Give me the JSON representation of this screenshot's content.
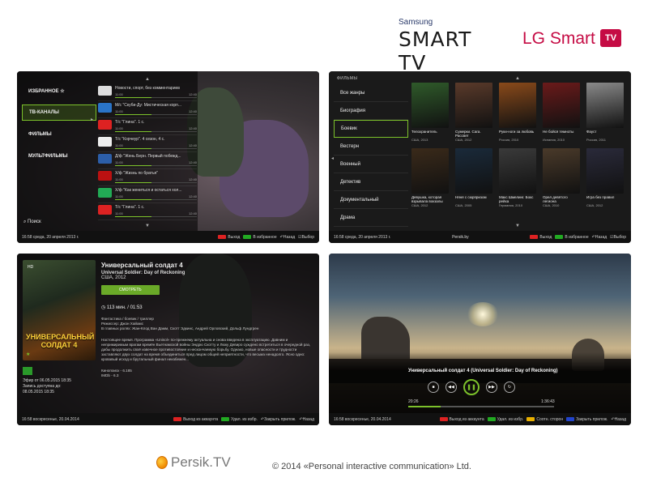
{
  "brands": {
    "samsung_top": "Samsung",
    "samsung_main": "SMART TV",
    "lg_text": "LG Smart",
    "lg_badge": "TV"
  },
  "panel1": {
    "menu": [
      "ИЗБРАННОЕ ☆",
      "ТВ-КАНАЛЫ",
      "ФИЛЬМЫ",
      "МУЛЬТФИЛЬМЫ"
    ],
    "active_menu": 1,
    "search_label": "Поиск",
    "channels": [
      {
        "num": "",
        "title": "Новости, спорт, без комментариев",
        "start": "11:00",
        "end": "12:40",
        "progress": 0.45,
        "logo": "#ddd"
      },
      {
        "num": "",
        "title": "М/с \"Скуби-Ду: Мистическая корп...",
        "start": "11:00",
        "end": "12:40",
        "progress": 0.45,
        "logo": "#2a74c8"
      },
      {
        "num": "",
        "title": "Т/с \"Глина\". 1 с.",
        "start": "11:00",
        "end": "12:40",
        "progress": 0.45,
        "logo": "#d22"
      },
      {
        "num": "",
        "title": "Т/с \"Корчеур\". 4 сезон, 4 с.",
        "start": "11:00",
        "end": "12:40",
        "progress": 0.45,
        "logo": "#eee"
      },
      {
        "num": "",
        "title": "Д/ф \"Жень Берн. Первый побежд...",
        "start": "11:00",
        "end": "12:40",
        "progress": 0.45,
        "logo": "#2c5ea8"
      },
      {
        "num": "",
        "title": "Х/ф \"Жизнь по братья\"",
        "start": "11:00",
        "end": "12:40",
        "progress": 0.45,
        "logo": "#b11"
      },
      {
        "num": "",
        "title": "Х/ф \"Как жениться и остаться хол...",
        "start": "11:00",
        "end": "12:40",
        "progress": 0.45,
        "logo": "#2a5"
      },
      {
        "num": "",
        "title": "Т/с \"Глина\". 1 с.",
        "start": "11:00",
        "end": "12:40",
        "progress": 0.45,
        "logo": "#d22"
      }
    ],
    "status_left": "16:58  среда, 20 апреля 2013 г.",
    "hints": [
      {
        "key": "red",
        "label": "Выход"
      },
      {
        "key": "green",
        "label": "В избранное"
      },
      {
        "key": "none",
        "label": "Назад"
      },
      {
        "key": "none",
        "label": "Выбор"
      }
    ]
  },
  "panel2": {
    "section": "ФИЛЬМЫ",
    "genres": [
      "Все жанры",
      "Биография",
      "Боевик",
      "Вестерн",
      "Военный",
      "Детектив",
      "Документальный",
      "Драма"
    ],
    "active_genre": 2,
    "posters": [
      {
        "title": "Телохранитель",
        "meta": "США, 2013",
        "color": "#2f5a2a"
      },
      {
        "title": "Сумерки. Сага. Рассвет",
        "meta": "США, 2012",
        "color": "#5a3a2a"
      },
      {
        "title": "Руки-ноги за любовь",
        "meta": "Россия, 2010",
        "color": "#8a4a1a"
      },
      {
        "title": "Не бойся темноты",
        "meta": "Испания, 2010",
        "color": "#6a1a1a"
      },
      {
        "title": "Фауст",
        "meta": "Россия, 2011",
        "color": "#8a8a8a"
      },
      {
        "title": "Девушка, которая взрывала вокзалы",
        "meta": "США, 2012",
        "color": "#3a2a1a"
      },
      {
        "title": "Няня с сюрпризом",
        "meta": "США, 2005",
        "color": "#1a2a3a"
      },
      {
        "title": "Макс Шмелинг. Бокс рейха",
        "meta": "Германия, 2010",
        "color": "#3a3a3a"
      },
      {
        "title": "Орел девятого легиона",
        "meta": "США, 2010",
        "color": "#4a3a2a"
      },
      {
        "title": "Игра без правил",
        "meta": "США, 2012",
        "color": "#2a2a3a"
      }
    ],
    "status_left": "16:58  среда, 20 апреля 2013 г.",
    "center_logo": "Persik.by",
    "hints": [
      {
        "key": "red",
        "label": "Выход"
      },
      {
        "key": "green",
        "label": "В избранное"
      },
      {
        "key": "none",
        "label": "Назад"
      },
      {
        "key": "none",
        "label": "Выбор"
      }
    ]
  },
  "panel3": {
    "poster_title": "УНИВЕРСАЛЬНЫЙ СОЛДАТ 4",
    "poster_badge": "HD",
    "title": "Универсальный солдат 4",
    "original_title": "Universal Soldier: Day of Reckoning",
    "country_year": "США, 2012",
    "watch_label": "СМОТРЕТЬ",
    "duration": "113 мин. / 01:53",
    "genre": "Фантастика / боевик / триллер",
    "director": "Режиссер: Джон Хайамс",
    "cast": "В главных ролях: Жан-Клод Ван Дамм, Скотт Эдкинс, Андрей Орловский, Дольф Лундгрен",
    "description": "Настоящее время. Программа «Unisol» по-прежнему актуальна и снова введена в эксплуатацию. Давним и непримиримым врагам времён Вьетнамской войны Эндрю Скотту и Люку Девиро суждено встретиться в очередной раз, дабы продолжить своё извечное противостояние и нескончаемую борьбу. Однако, новые опасности и трудности заставляют двух солдат на время объединиться пред лицом общей неприятности, что весьма ненадолго. Ясно одно: кровавый исход и брутальный финал неизбежен...",
    "kinopoisk": "Кинопоиск - 6.185",
    "imdb": "IMDb - 6.3",
    "air_line1": "Эфир от 06.05.2015   18:35",
    "air_line2": "Запись доступна до:",
    "air_line3": "08.05.2015   18:35",
    "status_left": "16:58   воскресенье, 20.04.2014",
    "hints": [
      {
        "key": "red",
        "label": "Выход из аккаунта"
      },
      {
        "key": "green",
        "label": "Удал. из избр."
      },
      {
        "key": "none",
        "label": "Закрыть прилож."
      },
      {
        "key": "none",
        "label": "Назад"
      }
    ]
  },
  "panel4": {
    "title": "Универсальный солдат 4 (Universal Soldier: Day of Reckoning)",
    "time_current": "20:26",
    "time_total": "1:36:43",
    "progress": 0.22,
    "status_left": "16:58   воскресенье, 20.04.2014",
    "hints": [
      {
        "key": "red",
        "label": "Выход из аккаунта"
      },
      {
        "key": "green",
        "label": "Удал. из избр."
      },
      {
        "key": "yellow",
        "label": "Соотн. сторон"
      },
      {
        "key": "blue",
        "label": "Закрыть прилож."
      },
      {
        "key": "none",
        "label": "Назад"
      }
    ]
  },
  "footer": {
    "brand": "Persik.TV",
    "copyright": "© 2014  «Personal interactive communication» Ltd."
  }
}
